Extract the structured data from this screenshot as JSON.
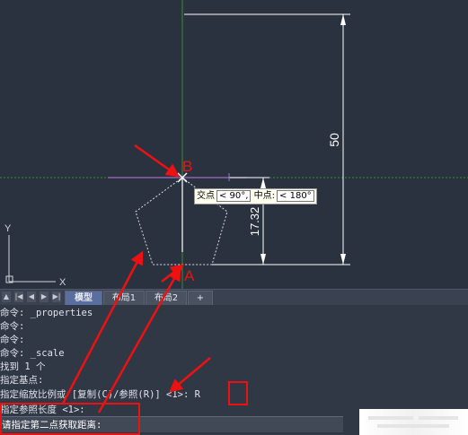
{
  "canvas": {
    "dimension_vertical": "50",
    "dimension_short": "17.32",
    "ucs_y": "Y",
    "ucs_x": "X",
    "tooltip": {
      "label": "交点",
      "box1": "< 90°,",
      "mid": "中点:",
      "box2": "< 180°"
    }
  },
  "annotations": {
    "point_b": "B",
    "point_a": "A"
  },
  "tabbar": {
    "tabs": [
      {
        "label": "模型",
        "active": true
      },
      {
        "label": "布局1",
        "active": false
      },
      {
        "label": "布局2",
        "active": false
      },
      {
        "label": "+",
        "active": false
      }
    ]
  },
  "command_history": [
    "命令: _properties",
    "命令:",
    "命令:",
    "命令: _scale",
    "找到 1 个",
    "指定基点:",
    "指定缩放比例或 [复制(C)/参照(R)] <1>: R",
    "指定参照长度 <1>:"
  ],
  "command_input": "请指定第二点获取距离:",
  "colors": {
    "canvas_bg": "#2b323f",
    "annotation": "#ee1111",
    "construction_line": "#a070c8",
    "axis_green": "#3a8a3a"
  }
}
